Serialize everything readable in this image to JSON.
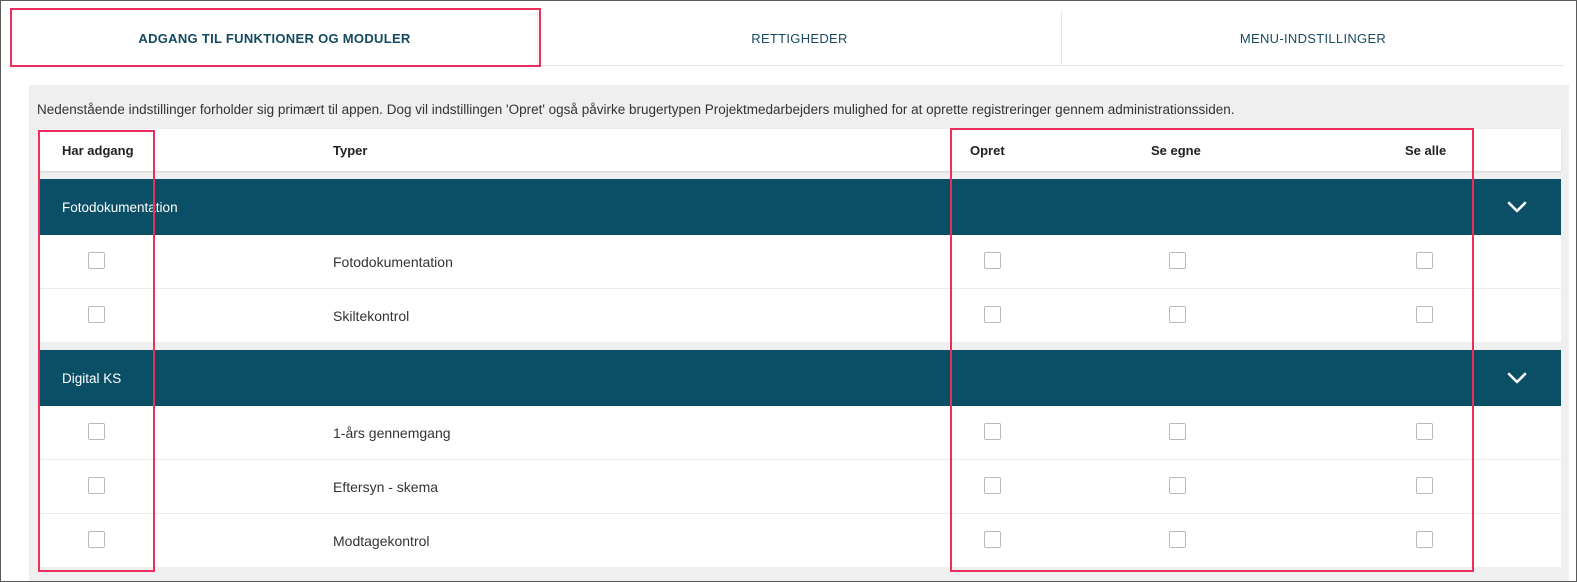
{
  "tabs": [
    {
      "label": "ADGANG TIL FUNKTIONER OG MODULER",
      "active": true
    },
    {
      "label": "RETTIGHEDER",
      "active": false
    },
    {
      "label": "MENU-INDSTILLINGER",
      "active": false
    }
  ],
  "intro": "Nedenstående indstillinger forholder sig primært til appen. Dog vil indstillingen 'Opret' også påvirke brugertypen Projektmedarbejders mulighed for at oprette registreringer gennem administrationssiden.",
  "columns": {
    "access": "Har adgang",
    "types": "Typer",
    "create": "Opret",
    "see_own": "Se egne",
    "see_all": "Se alle"
  },
  "groups": [
    {
      "name": "Fotodokumentation",
      "items": [
        {
          "label": "Fotodokumentation"
        },
        {
          "label": "Skiltekontrol"
        }
      ]
    },
    {
      "name": "Digital KS",
      "items": [
        {
          "label": "1-års gennemgang"
        },
        {
          "label": "Eftersyn - skema"
        },
        {
          "label": "Modtagekontrol"
        }
      ]
    }
  ],
  "icons": {
    "group_toggle": "chevron-down-icon"
  },
  "colors": {
    "group_header_bg": "#0b4f66",
    "highlight": "#ec2e5c",
    "tab_text": "#1b4a63"
  }
}
